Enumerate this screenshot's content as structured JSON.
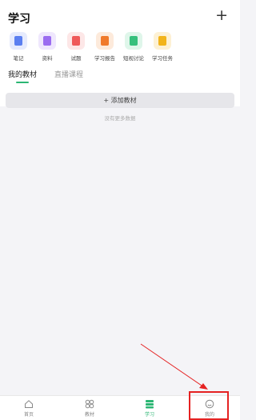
{
  "header": {
    "title": "学习",
    "add_symbol": "+"
  },
  "shortcuts": [
    {
      "label": "笔记",
      "icon": "note-icon",
      "color": "#5b7ff0",
      "bg": "#e6ebfd"
    },
    {
      "label": "资料",
      "icon": "folder-icon",
      "color": "#9b6cf0",
      "bg": "#efe7fd"
    },
    {
      "label": "试题",
      "icon": "exam-icon",
      "color": "#ef5a5a",
      "bg": "#fde7e7"
    },
    {
      "label": "学习报告",
      "icon": "report-icon",
      "color": "#f07a2b",
      "bg": "#fdeadb"
    },
    {
      "label": "短视讨论",
      "icon": "chat-icon",
      "color": "#36c07c",
      "bg": "#dff6ea"
    },
    {
      "label": "学习任务",
      "icon": "task-icon",
      "color": "#f2b41b",
      "bg": "#fdf1d4"
    }
  ],
  "tabs": [
    {
      "label": "我的教材",
      "active": true
    },
    {
      "label": "直播课程",
      "active": false
    }
  ],
  "add_book_label": "+ 添加教材",
  "empty_text": "没有更多数据",
  "bottom_nav": [
    {
      "label": "首页",
      "icon": "home-icon",
      "active": false
    },
    {
      "label": "教材",
      "icon": "books-icon",
      "active": false
    },
    {
      "label": "学习",
      "icon": "study-icon",
      "active": true
    },
    {
      "label": "我的",
      "icon": "profile-icon",
      "active": false
    }
  ],
  "colors": {
    "accent": "#2bb673",
    "highlight": "#e52222"
  }
}
